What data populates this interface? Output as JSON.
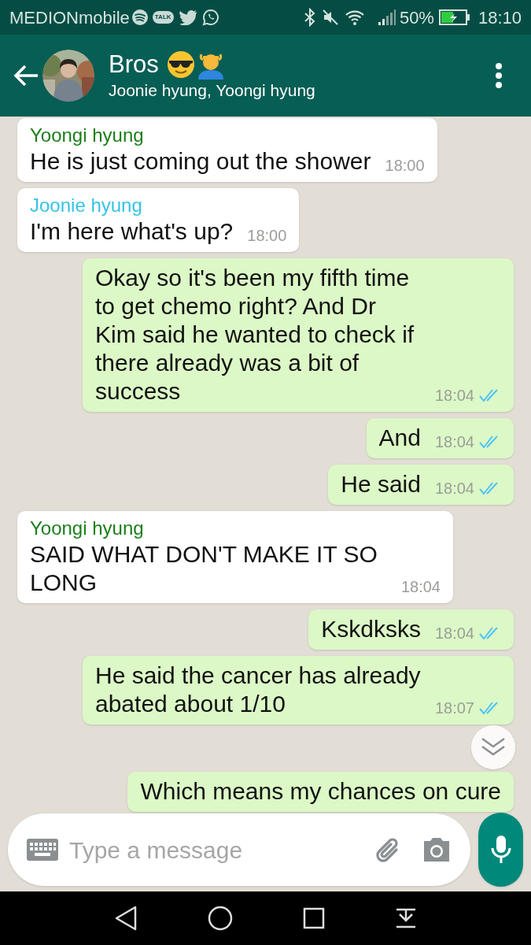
{
  "status_bar": {
    "carrier": "MEDIONmobile",
    "talk_badge": "TALK",
    "battery": "50%",
    "time": "18:10"
  },
  "header": {
    "title": "Bros",
    "subtitle": "Joonie hyung, Yoongi hyung"
  },
  "messages": [
    {
      "kind": "incoming",
      "sender": "Yoongi hyung",
      "color": "#1b7f1b",
      "text": "He is just coming out the shower",
      "time": "18:00"
    },
    {
      "kind": "incoming",
      "sender": "Joonie hyung",
      "color": "#35c3e6",
      "text": "I'm here what's up?",
      "time": "18:00"
    },
    {
      "kind": "outgoing",
      "text": "Okay so it's been my fifth time to get chemo right? And Dr Kim said he wanted to check if there already was a bit of success",
      "time": "18:04",
      "read": true
    },
    {
      "kind": "outgoing",
      "text": "And",
      "time": "18:04",
      "read": true
    },
    {
      "kind": "outgoing",
      "text": "He said",
      "time": "18:04",
      "read": true
    },
    {
      "kind": "incoming",
      "sender": "Yoongi hyung",
      "color": "#1b7f1b",
      "text": "SAID WHAT DON'T MAKE IT SO LONG",
      "time": "18:04"
    },
    {
      "kind": "outgoing",
      "text": "Kskdksks",
      "time": "18:04",
      "read": true
    },
    {
      "kind": "outgoing",
      "text": "He said the cancer has already abated about 1/10",
      "time": "18:07",
      "read": true,
      "scroll_button": true
    },
    {
      "kind": "outgoing",
      "text": "Which means my chances on cure"
    }
  ],
  "composer": {
    "placeholder": "Type a message"
  }
}
